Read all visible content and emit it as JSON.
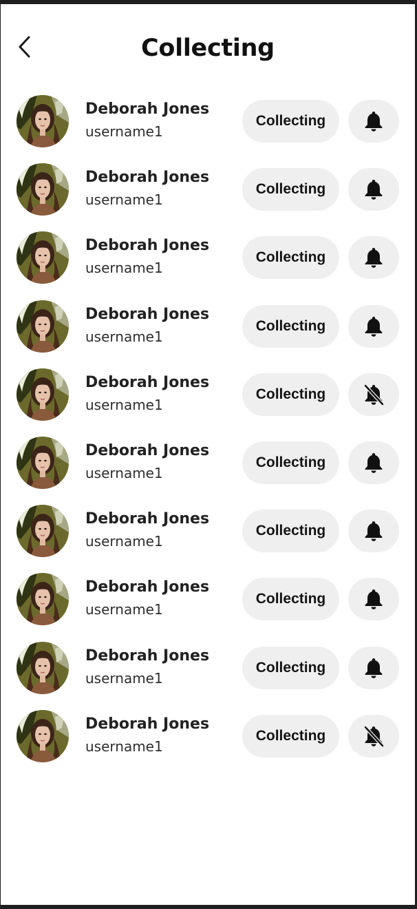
{
  "header": {
    "title": "Collecting",
    "back_icon": "chevron-left-icon"
  },
  "rows": [
    {
      "name": "Deborah Jones",
      "username": "username1",
      "button_label": "Collecting",
      "notifications": "on"
    },
    {
      "name": "Deborah Jones",
      "username": "username1",
      "button_label": "Collecting",
      "notifications": "on"
    },
    {
      "name": "Deborah Jones",
      "username": "username1",
      "button_label": "Collecting",
      "notifications": "on"
    },
    {
      "name": "Deborah Jones",
      "username": "username1",
      "button_label": "Collecting",
      "notifications": "on"
    },
    {
      "name": "Deborah Jones",
      "username": "username1",
      "button_label": "Collecting",
      "notifications": "off"
    },
    {
      "name": "Deborah Jones",
      "username": "username1",
      "button_label": "Collecting",
      "notifications": "on"
    },
    {
      "name": "Deborah Jones",
      "username": "username1",
      "button_label": "Collecting",
      "notifications": "on"
    },
    {
      "name": "Deborah Jones",
      "username": "username1",
      "button_label": "Collecting",
      "notifications": "on"
    },
    {
      "name": "Deborah Jones",
      "username": "username1",
      "button_label": "Collecting",
      "notifications": "on"
    },
    {
      "name": "Deborah Jones",
      "username": "username1",
      "button_label": "Collecting",
      "notifications": "off"
    }
  ],
  "icons": {
    "bell_on": "bell-icon",
    "bell_off": "bell-off-icon"
  },
  "colors": {
    "button_background": "#efefef",
    "text_primary": "#222222",
    "frame": "#1f1f1f"
  }
}
